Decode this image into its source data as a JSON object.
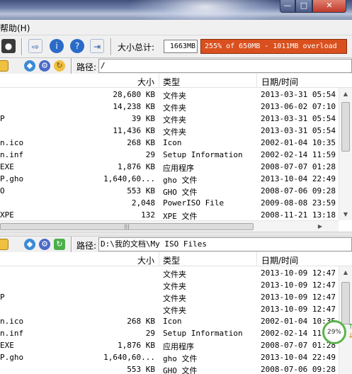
{
  "menu": {
    "help": "帮助(H)"
  },
  "toolbar": {
    "total_label": "大小总计:",
    "total_value": "1663MB",
    "overload_text": "255% of 650MB - 1011MB overload"
  },
  "top_pane": {
    "path_label": "路径:",
    "path": "/",
    "columns": {
      "size": "大小",
      "type": "类型",
      "date": "日期/时间"
    },
    "rows": [
      {
        "name": "",
        "size": "28,680 KB",
        "type": "文件夹",
        "date": "2013-03-31 05:54"
      },
      {
        "name": "",
        "size": "14,238 KB",
        "type": "文件夹",
        "date": "2013-06-02 07:10"
      },
      {
        "name": "P",
        "size": "39 KB",
        "type": "文件夹",
        "date": "2013-03-31 05:54"
      },
      {
        "name": "",
        "size": "11,436 KB",
        "type": "文件夹",
        "date": "2013-03-31 05:54"
      },
      {
        "name": "n.ico",
        "size": "268 KB",
        "type": "Icon",
        "date": "2002-01-04 10:35"
      },
      {
        "name": "n.inf",
        "size": "29",
        "type": "Setup Information",
        "date": "2002-02-14 11:59"
      },
      {
        "name": "EXE",
        "size": "1,876 KB",
        "type": "应用程序",
        "date": "2008-07-07 01:28"
      },
      {
        "name": "P.gho",
        "size": "1,640,60...",
        "type": "gho 文件",
        "date": "2013-10-04 22:49"
      },
      {
        "name": "O",
        "size": "553 KB",
        "type": "GHO 文件",
        "date": "2008-07-06 09:28"
      },
      {
        "name": "",
        "size": "2,048",
        "type": "PowerISO File",
        "date": "2009-08-08 23:59"
      },
      {
        "name": "XPE",
        "size": "132",
        "type": "XPE 文件",
        "date": "2008-11-21 13:18"
      }
    ]
  },
  "bottom_pane": {
    "path_label": "路径:",
    "path": "D:\\我的文档\\My ISO Files",
    "columns": {
      "size": "大小",
      "type": "类型",
      "date": "日期/时间"
    },
    "rows": [
      {
        "name": "",
        "size": "",
        "type": "文件夹",
        "date": "2013-10-09 12:47"
      },
      {
        "name": "",
        "size": "",
        "type": "文件夹",
        "date": "2013-10-09 12:47"
      },
      {
        "name": "P",
        "size": "",
        "type": "文件夹",
        "date": "2013-10-09 12:47"
      },
      {
        "name": "",
        "size": "",
        "type": "文件夹",
        "date": "2013-10-09 12:47"
      },
      {
        "name": "n.ico",
        "size": "268 KB",
        "type": "Icon",
        "date": "2002-01-04 10:35"
      },
      {
        "name": "n.inf",
        "size": "29",
        "type": "Setup Information",
        "date": "2002-02-14 11:59"
      },
      {
        "name": "EXE",
        "size": "1,876 KB",
        "type": "应用程序",
        "date": "2008-07-07 01:28"
      },
      {
        "name": "P.gho",
        "size": "1,640,60...",
        "type": "gho 文件",
        "date": "2013-10-04 22:49"
      },
      {
        "name": "",
        "size": "553 KB",
        "type": "GHO 文件",
        "date": "2008-07-06 09:28"
      }
    ]
  },
  "progress_badge": {
    "value": "29%"
  },
  "colors": {
    "overload_bg": "#d9501e",
    "badge_ring": "#5cb34a"
  }
}
